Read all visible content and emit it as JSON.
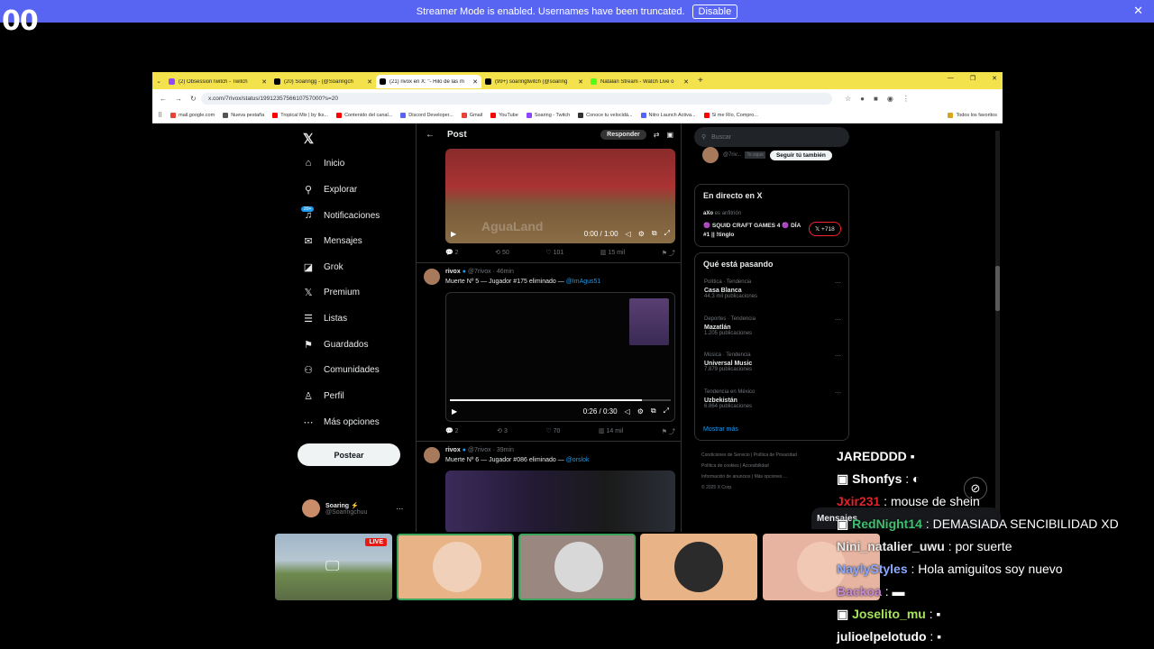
{
  "overlay": {
    "counter": "00",
    "banner_text": "Streamer Mode is enabled. Usernames have been truncated.",
    "banner_button": "Disable",
    "banner_close": "✕"
  },
  "browser": {
    "tabs": [
      {
        "label": "(2) ObsessionTwitch - Twitch",
        "color": "#9146ff"
      },
      {
        "label": "(20) Soaringg - (@Soaringch",
        "color": "#000000"
      },
      {
        "label": "(21) rivox en X: \"- Hilo de las m",
        "color": "#000000"
      },
      {
        "label": "(99+) soaringtwitch (@soaring",
        "color": "#000000"
      },
      {
        "label": "Natalan Stream - Watch Live o",
        "color": "#53fc18"
      }
    ],
    "url": "x.com/7rivox/status/1991235756610757000?s=20",
    "bookmarks": [
      {
        "label": "mail.google.com",
        "color": "#ea4335"
      },
      {
        "label": "Nueva pestaña",
        "color": "#555555"
      },
      {
        "label": "Tropical Mix | by Iks...",
        "color": "#ff0000"
      },
      {
        "label": "Contenido del canal...",
        "color": "#ff0000"
      },
      {
        "label": "Discord Developer...",
        "color": "#5865f2"
      },
      {
        "label": "Gmail",
        "color": "#ea4335"
      },
      {
        "label": "YouTube",
        "color": "#ff0000"
      },
      {
        "label": "Soaring - Twitch",
        "color": "#9146ff"
      },
      {
        "label": "Conoce tu velocidá...",
        "color": "#333333"
      },
      {
        "label": "Nitro Launch Activa...",
        "color": "#5865f2"
      },
      {
        "label": "Si me Río, Compro...",
        "color": "#ff0000"
      }
    ],
    "all_bookmarks": "Todos los favoritos"
  },
  "x": {
    "nav": [
      {
        "label": "Inicio",
        "icon": "home-icon",
        "glyph": "⌂"
      },
      {
        "label": "Explorar",
        "icon": "search-icon",
        "glyph": "⚲"
      },
      {
        "label": "Notificaciones",
        "icon": "bell-icon",
        "glyph": "♫"
      },
      {
        "label": "Mensajes",
        "icon": "mail-icon",
        "glyph": "✉"
      },
      {
        "label": "Grok",
        "icon": "grok-icon",
        "glyph": "◪"
      },
      {
        "label": "Premium",
        "icon": "x-icon",
        "glyph": "𝕏"
      },
      {
        "label": "Listas",
        "icon": "list-icon",
        "glyph": "☰"
      },
      {
        "label": "Guardados",
        "icon": "bookmark-icon",
        "glyph": "⚑"
      },
      {
        "label": "Comunidades",
        "icon": "people-icon",
        "glyph": "⚇"
      },
      {
        "label": "Perfil",
        "icon": "user-icon",
        "glyph": "♙"
      },
      {
        "label": "Más opciones",
        "icon": "more-icon",
        "glyph": "⋯"
      }
    ],
    "notif_badge": "20+",
    "post_button": "Postear",
    "account": {
      "name": "Soaring ⚡",
      "handle": "@Soaringchuu"
    },
    "header": {
      "title": "Post",
      "reply": "Responder"
    },
    "video1": {
      "time": "0:00 / 1:00",
      "watermark": "AguaLand"
    },
    "actions1": {
      "replies": "2",
      "reposts": "50",
      "likes": "101",
      "views": "15 mil"
    },
    "tweet2": {
      "name": "rivox",
      "handle": "@7rivox · 46min",
      "text": "Muerte Nº 5 — Jugador #175 eliminado — ",
      "mention": "@ImAgus51"
    },
    "video2": {
      "time": "0:26 / 0:30"
    },
    "actions2": {
      "replies": "2",
      "reposts": "3",
      "likes": "70",
      "views": "14 mil"
    },
    "tweet3": {
      "name": "rivox",
      "handle": "@7rivox · 39min",
      "text": "Muerte Nº 6 — Jugador #086 eliminado — ",
      "mention": "@orslok"
    },
    "search_placeholder": "Buscar",
    "follow": {
      "handle": "@7riv...",
      "follows_you": "Te sigue",
      "button": "Seguir tú también"
    },
    "live": {
      "title": "En directo en X",
      "host": "aXo",
      "host_role": "es anfitrión",
      "event": "🟣 SQUID CRAFT GAMES 4 🟣 DÍA #1 || !tinglo",
      "listeners": "+718"
    },
    "trending": {
      "title": "Qué está pasando",
      "items": [
        {
          "category": "Política · Tendencia",
          "name": "Casa Blanca",
          "count": "44,3 mil publicaciones"
        },
        {
          "category": "Deportes · Tendencia",
          "name": "Mazatlán",
          "count": "1.205 publicaciones"
        },
        {
          "category": "Música · Tendencia",
          "name": "Universal Music",
          "count": "7.879 publicaciones"
        },
        {
          "category": "Tendencia en México",
          "name": "Uzbekistán",
          "count": "6.864 publicaciones"
        }
      ],
      "show_more": "Mostrar más"
    },
    "footer": [
      "Condiciones de Servicio",
      "Política de Privacidad",
      "Política de cookies",
      "Accesibilidad",
      "Información de anuncios",
      "Más opciones ...",
      "© 2025 X Corp."
    ],
    "messages_drawer": "Mensajes"
  },
  "stream": {
    "live_badge": "LIVE"
  },
  "chat": [
    {
      "user": "JAREDDDD",
      "msg": "",
      "color": "#ffffff"
    },
    {
      "user": "Shonfys",
      "msg": " : ",
      "color": "#ffffff"
    },
    {
      "user": "Jxir231",
      "msg": " : mouse de shein",
      "color": "#e0242a"
    },
    {
      "user": "RedNight14",
      "msg": " : DEMASIADA SENCIBILIDAD XD",
      "color": "#3fbf6f"
    },
    {
      "user": "Nini_natalier_uwu",
      "msg": " : por suerte",
      "color": "#e8e8e8"
    },
    {
      "user": "NaylyStyles",
      "msg": " : Hola amiguitos soy nuevo",
      "color": "#8aa9ff"
    },
    {
      "user": "Backoa",
      "msg": " : ",
      "color": "#c98ad6"
    },
    {
      "user": "Joselito_mu",
      "msg": " : ",
      "color": "#a6e35a"
    },
    {
      "user": "julioelpelotudo",
      "msg": " : ",
      "color": "#ffffff"
    }
  ]
}
